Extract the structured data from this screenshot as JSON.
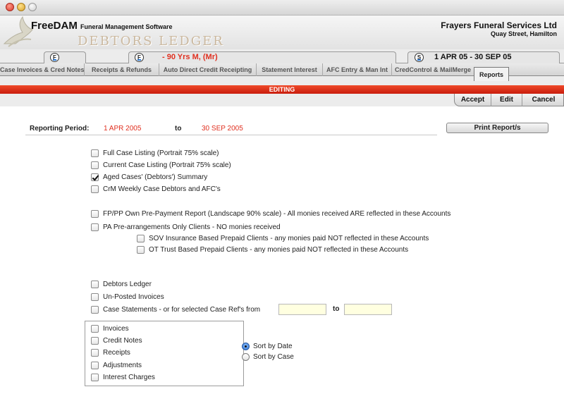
{
  "header": {
    "app_name": "FreeDAM",
    "app_subtitle": "Funeral Management Software",
    "module_title": "DEBTORS LEDGER",
    "company_name": "Frayers Funeral Services Ltd",
    "company_location": "Quay Street, Hamilton",
    "client_info": "- 90 Yrs M, (Mr)",
    "period": "1 APR 05  -  30 SEP 05",
    "badges": [
      "F",
      "F",
      "S"
    ]
  },
  "module_tabs": [
    "Case Invoices & Cred Notes",
    "Receipts & Refunds",
    "Auto Direct Credit Receipting",
    "Statement Interest",
    "AFC Entry & Man Int",
    "CredControl & MailMerge",
    "Reports"
  ],
  "active_tab": "Reports",
  "mode_bar": "EDITING",
  "actions": {
    "accept": "Accept",
    "edit": "Edit",
    "cancel": "Cancel"
  },
  "reporting_period": {
    "label": "Reporting Period:",
    "from": "1 APR 2005",
    "to_label": "to",
    "to": "30 SEP 2005"
  },
  "print_button": "Print Report/s",
  "options_group1": [
    {
      "label": "Full Case Listing (Portrait 75% scale)",
      "checked": false
    },
    {
      "label": "Current Case Listing (Portrait 75% scale)",
      "checked": false
    },
    {
      "label": "Aged Cases' (Debtors') Summary",
      "checked": true
    },
    {
      "label": "CrM Weekly Case Debtors and AFC's",
      "checked": false
    }
  ],
  "options_group2": [
    {
      "label": "FP/PP Own Pre-Payment Report (Landscape 90% scale) - All monies received ARE reflected in these Accounts",
      "checked": false
    },
    {
      "label": "PA  Pre-arrangements Only Clients - NO monies received",
      "checked": false
    },
    {
      "label": "SOV  Insurance Based Prepaid Clients - any monies paid NOT reflected in these Accounts",
      "checked": false
    },
    {
      "label": "OT  Trust Based Prepaid Clients - any monies paid NOT reflected in these Accounts",
      "checked": false
    }
  ],
  "options_group3": [
    {
      "label": "Debtors Ledger",
      "checked": false
    },
    {
      "label": "Un-Posted Invoices",
      "checked": false
    },
    {
      "label": "Case Statements - or for selected Case Ref's from",
      "checked": false
    }
  ],
  "case_ref": {
    "from": "",
    "to_label": "to",
    "to": ""
  },
  "transaction_types": [
    {
      "label": "Invoices",
      "checked": false
    },
    {
      "label": "Credit Notes",
      "checked": false
    },
    {
      "label": "Receipts",
      "checked": false
    },
    {
      "label": "Adjustments",
      "checked": false
    },
    {
      "label": "Interest Charges",
      "checked": false
    }
  ],
  "sort_options": [
    {
      "label": "Sort by Date",
      "selected": true
    },
    {
      "label": "Sort by Case",
      "selected": false
    }
  ],
  "colors": {
    "accent_red": "#e03020",
    "edit_bar": "#d8281a",
    "field_yellow": "#ffffe0"
  }
}
